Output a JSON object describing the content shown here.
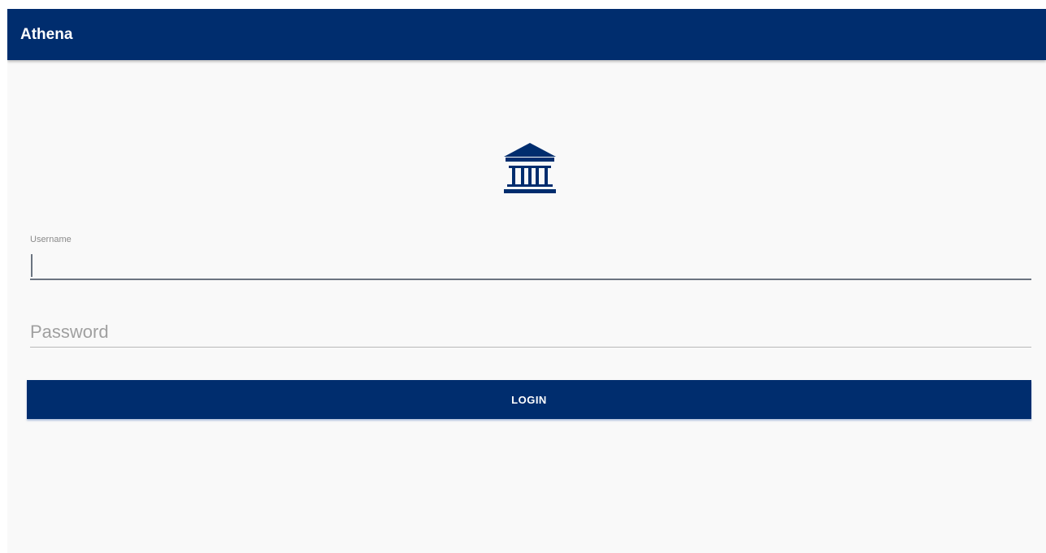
{
  "app_bar": {
    "title": "Athena",
    "color": "#002d6e"
  },
  "logo": {
    "icon": "bank-building-icon",
    "color": "#002d6e"
  },
  "login_form": {
    "username": {
      "label": "Username",
      "value": ""
    },
    "password": {
      "placeholder": "Password",
      "value": ""
    },
    "login_label": "LOGIN"
  }
}
